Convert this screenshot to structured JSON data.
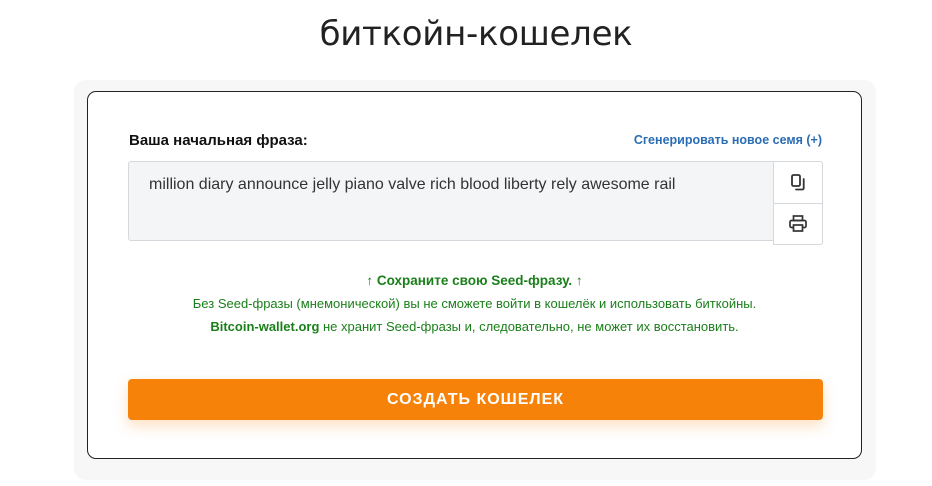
{
  "page": {
    "title": "биткойн-кошелек"
  },
  "seed": {
    "label": "Ваша начальная фраза:",
    "generate_link": "Сгенерировать новое семя (+)",
    "phrase": "million diary announce jelly piano valve rich blood liberty rely awesome rail",
    "actions": {
      "copy_icon": "copy-icon",
      "print_icon": "printer-icon"
    }
  },
  "notice": {
    "title": "↑ Сохраните свою Seed-фразу. ↑",
    "line1": "Без Seed-фразы (мнемонической) вы не сможете войти в кошелёк и использовать биткойны.",
    "brand": "Bitcoin-wallet.org",
    "line2_rest": " не хранит Seed-фразы и, следовательно, не может их восстановить."
  },
  "create_button": {
    "label": "СОЗДАТЬ КОШЕЛЕК"
  },
  "colors": {
    "accent": "#f7820a",
    "link": "#2a6db5",
    "notice_green": "#1a7f1a"
  }
}
